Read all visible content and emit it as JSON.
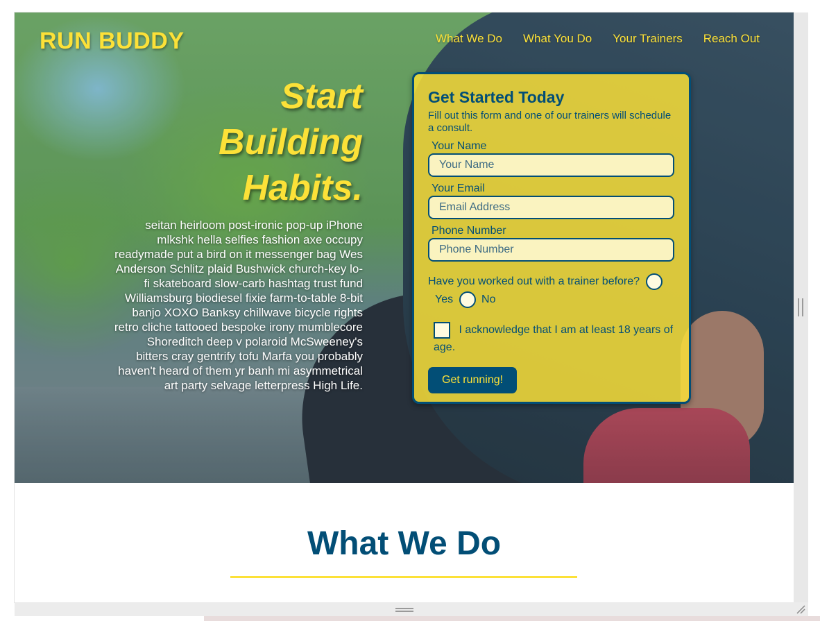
{
  "header": {
    "logo": "RUN BUDDY",
    "nav": [
      "What We Do",
      "What You Do",
      "Your Trainers",
      "Reach Out"
    ]
  },
  "hero": {
    "title_lines": [
      "Start",
      "Building",
      "Habits."
    ],
    "text": "seitan heirloom post-ironic pop-up iPhone mlkshk hella selfies fashion axe occupy readymade put a bird on it messenger bag Wes Anderson Schlitz plaid Bushwick church-key lo-fi skateboard slow-carb hashtag trust fund Williamsburg biodiesel fixie farm-to-table 8-bit banjo XOXO Banksy chillwave bicycle rights retro cliche tattooed bespoke irony mumblecore Shoreditch deep v polaroid McSweeney's bitters cray gentrify tofu Marfa you probably haven't heard of them yr banh mi asymmetrical art party selvage letterpress High Life."
  },
  "form": {
    "title": "Get Started Today",
    "subtitle": "Fill out this form and one of our trainers will schedule a consult.",
    "name_label": "Your Name",
    "name_placeholder": "Your Name",
    "email_label": "Your Email",
    "email_placeholder": "Email Address",
    "phone_label": "Phone Number",
    "phone_placeholder": "Phone Number",
    "question": "Have you worked out with a trainer before?",
    "option_yes": "Yes",
    "option_no": "No",
    "acknowledge": "I acknowledge that I am at least 18 years of age.",
    "submit": "Get running!"
  },
  "section": {
    "title": "What We Do"
  },
  "colors": {
    "brand_yellow": "#fce138",
    "brand_blue": "#024e76"
  }
}
